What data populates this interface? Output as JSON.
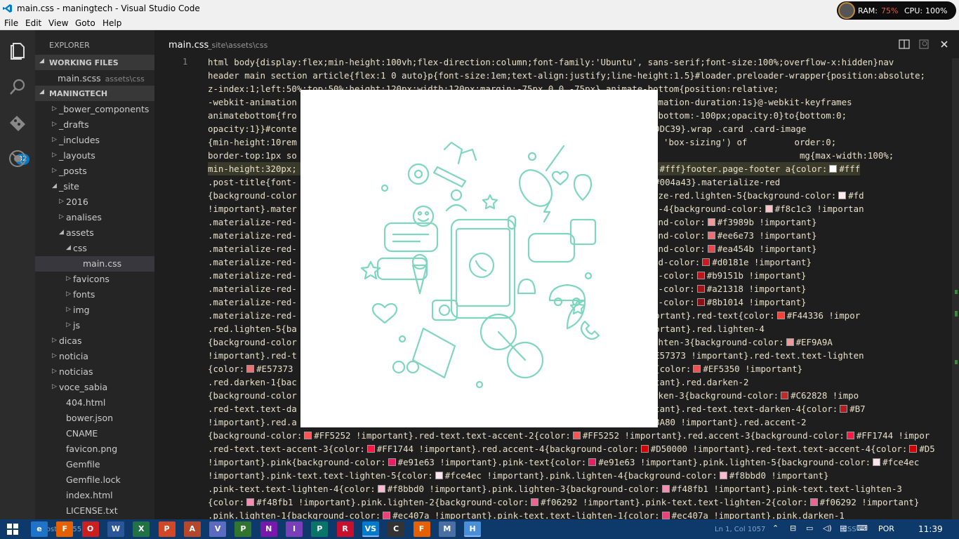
{
  "window": {
    "title": "main.css - maningtech - Visual Studio Code"
  },
  "perf_meter": {
    "ram_label": "RAM:",
    "ram_value": "75%",
    "cpu_label": "CPU:",
    "cpu_value": "100%"
  },
  "menu": [
    "File",
    "Edit",
    "View",
    "Goto",
    "Help"
  ],
  "activity": {
    "badge": "32"
  },
  "sidebar": {
    "title": "EXPLORER",
    "working_files_label": "WORKING FILES",
    "working_file": {
      "name": "main.scss",
      "path": "assets\\css"
    },
    "project_label": "MANINGTECH",
    "tree": [
      {
        "name": "_bower_components",
        "arrow": "▷"
      },
      {
        "name": "_drafts",
        "arrow": "▷"
      },
      {
        "name": "_includes",
        "arrow": "▷"
      },
      {
        "name": "_layouts",
        "arrow": "▷"
      },
      {
        "name": "_posts",
        "arrow": "▷"
      },
      {
        "name": "_site",
        "arrow": "◢"
      },
      {
        "name": "2016",
        "arrow": "▷"
      },
      {
        "name": "analises",
        "arrow": "▷"
      },
      {
        "name": "assets",
        "arrow": "◢"
      },
      {
        "name": "css",
        "arrow": "◢"
      },
      {
        "name": "main.css",
        "arrow": ""
      },
      {
        "name": "favicons",
        "arrow": "▷"
      },
      {
        "name": "fonts",
        "arrow": "▷"
      },
      {
        "name": "img",
        "arrow": "▷"
      },
      {
        "name": "js",
        "arrow": "▷"
      },
      {
        "name": "dicas",
        "arrow": "▷"
      },
      {
        "name": "noticia",
        "arrow": "▷"
      },
      {
        "name": "noticias",
        "arrow": "▷"
      },
      {
        "name": "voce_sabia",
        "arrow": "▷"
      },
      {
        "name": "404.html",
        "arrow": ""
      },
      {
        "name": "bower.json",
        "arrow": ""
      },
      {
        "name": "CNAME",
        "arrow": ""
      },
      {
        "name": "favicon.png",
        "arrow": ""
      },
      {
        "name": "Gemfile",
        "arrow": ""
      },
      {
        "name": "Gemfile.lock",
        "arrow": ""
      },
      {
        "name": "index.html",
        "arrow": ""
      },
      {
        "name": "LICENSE.txt",
        "arrow": ""
      }
    ]
  },
  "editor": {
    "tab_title": "main.css",
    "tab_path": "_site\\assets\\css",
    "line_number": "1",
    "code_lines": [
      {
        "text": "html body{display:flex;min-height:100vh;flex-direction:column;font-family:'Ubuntu', sans-serif;font-size:100%;overflow-x:hidden}nav",
        "swatch": ""
      },
      {
        "text": "header main section article{flex:1 0 auto}p{font-size:1em;text-align:justify;line-height:1.5}#loader.preloader-wrapper{position:absolute;",
        "swatch": ""
      },
      {
        "text": "z-index:1;left:50%;top:50%;height:120px;width:120px;margin:-75px 0 0 -75px}.animate-bottom{position:relative;",
        "swatch": ""
      },
      {
        "text": "-webkit-animation                                                      imatebottom;animation-duration:1s}@-webkit-keyframes",
        "swatch": ""
      },
      {
        "text": "animatebottom{fro                                                      atebottom{from{bottom:-100px;opacity:0}to{bottom:0;",
        "swatch": ""
      },
      {
        "text": "opacity:1}}#conte                                                     over{color:",
        "swatch": "#CDDC39",
        "after": "#CDDC39}.wrap .card .card-image"
      },
      {
        "text": "{min-height:10rem                                                     ea (depending on 'box-sizing') of         order:0;",
        "swatch": ""
      },
      {
        "text": "border-top:1px so                                                                                                mg{max-width:100%;",
        "swatch": ""
      },
      {
        "text": "min-height:320px;                                                     -footer{color:",
        "swatch": "#ffffff",
        "after": "#fff}footer.page-footer a{color:",
        "swatch2": "#ffffff",
        "after2": "#fff"
      },
      {
        "text": ".post-title{font-                                                     dow:2px -2px ",
        "swatch": "#004a43",
        "after": "#004a43}.materialize-red"
      },
      {
        "text": "{background-color                                                     rtant}.materialize-red.lighten-5{background-color:",
        "swatch": "#fdeaeb",
        "after": "#fd"
      },
      {
        "text": "!important}.mater                                                     lize-red.lighten-4{background-color:",
        "swatch": "#f8c1c3",
        "after": "#f8c1c3 !importan"
      },
      {
        "text": ".materialize-red-                                                     ghten-3{background-color:",
        "swatch": "#f3989b",
        "after": "#f3989b !important}"
      },
      {
        "text": ".materialize-red-                                                     ghten-2{background-color:",
        "swatch": "#ee6e73",
        "after": "#ee6e73 !important}"
      },
      {
        "text": ".materialize-red-                                                     ghten-1{background-color:",
        "swatch": "#ea454b",
        "after": "#ea454b !important}"
      },
      {
        "text": ".materialize-red-                                                     rken-1{background-color:",
        "swatch": "#d0181e",
        "after": "#d0181e !important}"
      },
      {
        "text": ".materialize-red-                                                     ken-2{background-color:",
        "swatch": "#b9151b",
        "after": "#b9151b !important}"
      },
      {
        "text": ".materialize-red-                                                     ken-3{background-color:",
        "swatch": "#a21318",
        "after": "#a21318 !important}"
      },
      {
        "text": ".materialize-red-                                                     ken-4{background-color:",
        "swatch": "#8b1014",
        "after": "#8b1014 !important}"
      },
      {
        "text": ".materialize-red-                                                     :",
        "swatch": "#F44336",
        "after": "#F44336 !important}.red-text{color:",
        "swatch2": "#F44336",
        "after2": "#F44336 !impor"
      },
      {
        "text": ".red.lighten-5{ba                                                     :",
        "swatch": "#FFEBEE",
        "after": "#FFEBEE !important}.red.lighten-4"
      },
      {
        "text": "{background-color                                                     portant}.red.lighten-3{background-color:",
        "swatch": "#EF9A9A",
        "after": "#EF9A9A"
      },
      {
        "text": "!important}.red-t                                                     round-color:",
        "swatch": "#E57373",
        "after": "#E57373 !important}.red-text.text-lighten"
      },
      {
        "text": "{color:",
        "swatch": "#E57373",
        "after": "#E57373                                               ed-text.text-lighten-1{color:",
        "swatch2": "#EF5350",
        "after2": "#EF5350 !important}"
      },
      {
        "text": ".red.darken-1{bac                                                    ",
        "swatch": "#E53935",
        "after": "#E53935 !important}.red.darken-2"
      },
      {
        "text": "{background-color                                                     portant}.red.darken-3{background-color:",
        "swatch": "#C62828",
        "after": "#C62828 !impo"
      },
      {
        "text": ".red-text.text-da                                                    ",
        "swatch": "#B71C1C",
        "after": "#B71C1C !important}.red-text.text-darken-4{color:",
        "swatch2": "#B71C1C",
        "after2": "#B7"
      },
      {
        "text": "!important}.red.a                                                     t-1{color:",
        "swatch": "#FF8A80",
        "after": "#FF8A80 !important}.red.accent-2"
      },
      {
        "text": "{background-color:",
        "swatch": "#FF5252",
        "after": "#FF5252 !important}.red-text.text-accent-2{color:",
        "swatch2": "#FF5252",
        "after2": "#FF5252 !important}.red.accent-3{background-color:",
        "swatch3": "#FF1744",
        "after3": "#FF1744 !impor"
      },
      {
        "text": ".red-text.text-accent-3{color:",
        "swatch": "#FF1744",
        "after": "#FF1744 !important}.red.accent-4{background-color:",
        "swatch2": "#D50000",
        "after2": "#D50000 !important}.red-text.text-accent-4{color:",
        "swatch3": "#D50000",
        "after3": "#D5"
      },
      {
        "text": "!important}.pink{background-color:",
        "swatch": "#e91e63",
        "after": "#e91e63 !important}.pink-text{color:",
        "swatch2": "#e91e63",
        "after2": "#e91e63 !important}.pink.lighten-5{background-color:",
        "swatch3": "#fce4ec",
        "after3": "#fce4ec"
      },
      {
        "text": "!important}.pink-text.text-lighten-5{color:",
        "swatch": "#fce4ec",
        "after": "#fce4ec !important}.pink.lighten-4{background-color:",
        "swatch2": "#f8bbd0",
        "after2": "#f8bbd0 !important}"
      },
      {
        "text": ".pink-text.text-lighten-4{color:",
        "swatch": "#f8bbd0",
        "after": "#f8bbd0 !important}.pink.lighten-3{background-color:",
        "swatch2": "#f48fb1",
        "after2": "#f48fb1 !important}.pink-text.text-lighten-3"
      },
      {
        "text": "{color:",
        "swatch": "#f48fb1",
        "after": "#f48fb1 !important}.pink.lighten-2{background-color:",
        "swatch2": "#f06292",
        "after2": "#f06292 !important}.pink-text.text-lighten-2{color:",
        "swatch3": "#f06292",
        "after3": "#f06292 !important}"
      },
      {
        "text": ".pink.lighten-1{background-color:",
        "swatch": "#ec407a",
        "after": "#ec407a !important}.pink-text.text-lighten-1{color:",
        "swatch2": "#ec407a",
        "after2": "#ec407a !important}.pink.darken-1"
      }
    ]
  },
  "status": {
    "left": "0  post  0  1 55",
    "position": "Ln 1, Col 1057",
    "language": "CSS"
  },
  "taskbar": {
    "apps": [
      "e",
      "F",
      "O",
      "W",
      "X",
      "P",
      "A",
      "V",
      "P",
      "N",
      "I",
      "P",
      "R",
      "VS",
      "C",
      "F",
      "M",
      "H"
    ],
    "lang": "POR",
    "time": "11:39"
  },
  "colors": {
    "accent": "#007acc",
    "illustration": "#7fd6c0"
  }
}
